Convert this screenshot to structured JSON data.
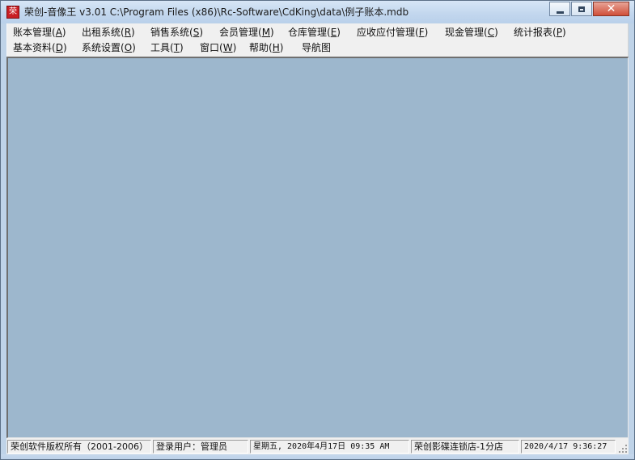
{
  "window": {
    "title": "荣创-音像王 v3.01 C:\\Program Files (x86)\\Rc-Software\\CdKing\\data\\例子账本.mdb",
    "icon": "app-seal-icon",
    "icon_glyph": "荣",
    "caption_buttons": {
      "minimize": "minimize-icon",
      "restore": "restore-icon",
      "close": "close-icon",
      "close_glyph": "✕"
    }
  },
  "menu": {
    "row1": [
      {
        "label": "账本管理(",
        "mnemonic": "A",
        "suffix": ")"
      },
      {
        "label": "出租系统(",
        "mnemonic": "R",
        "suffix": ")"
      },
      {
        "label": "销售系统(",
        "mnemonic": "S",
        "suffix": ")"
      },
      {
        "label": "会员管理(",
        "mnemonic": "M",
        "suffix": ")"
      },
      {
        "label": "仓库管理(",
        "mnemonic": "E",
        "suffix": ")"
      },
      {
        "label": "应收应付管理(",
        "mnemonic": "F",
        "suffix": ")"
      },
      {
        "label": "现金管理(",
        "mnemonic": "C",
        "suffix": ")"
      },
      {
        "label": "统计报表(",
        "mnemonic": "P",
        "suffix": ")"
      }
    ],
    "row2": [
      {
        "label": "基本资料(",
        "mnemonic": "D",
        "suffix": ")"
      },
      {
        "label": "系统设置(",
        "mnemonic": "O",
        "suffix": ")"
      },
      {
        "label": "工具(",
        "mnemonic": "T",
        "suffix": ")"
      },
      {
        "label": "窗口(",
        "mnemonic": "W",
        "suffix": ")"
      },
      {
        "label": "帮助(",
        "mnemonic": "H",
        "suffix": ")"
      },
      {
        "label": "导航图",
        "mnemonic": "",
        "suffix": ""
      }
    ]
  },
  "workspace": {
    "background": "#9db7cd"
  },
  "statusbar": {
    "copyright": "荣创软件版权所有（2001-2006）",
    "login_user": "登录用户：管理员",
    "date_time": "星期五, 2020年4月17日 09:35 AM",
    "store": "荣创影碟连锁店-1分店",
    "timestamp": "2020/4/17 9:36:27"
  },
  "colors": {
    "titlebar": "#c3d7ee",
    "menu_bg": "#f0f0f0",
    "close_button": "#d04f39",
    "workspace": "#9db7cd"
  }
}
